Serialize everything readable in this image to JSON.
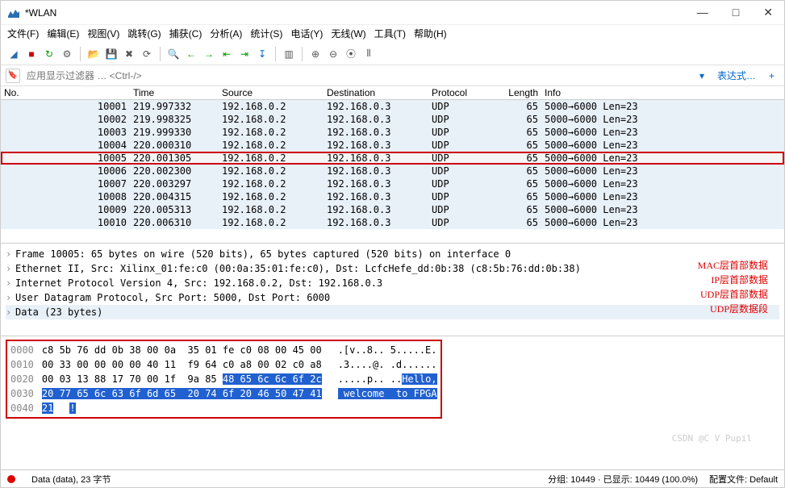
{
  "window": {
    "title": "*WLAN",
    "min": "—",
    "max": "□",
    "close": "✕"
  },
  "menu": {
    "file": "文件(F)",
    "edit": "编辑(E)",
    "view": "视图(V)",
    "goto": "跳转(G)",
    "capture": "捕获(C)",
    "analyze": "分析(A)",
    "stats": "统计(S)",
    "telephony": "电话(Y)",
    "wireless": "无线(W)",
    "tools": "工具(T)",
    "help": "帮助(H)"
  },
  "filter": {
    "placeholder": "应用显示过滤器 … <Ctrl-/>",
    "expr_label": "表达式…",
    "arrow": "▾",
    "plus": "+"
  },
  "columns": {
    "no": "No.",
    "time": "Time",
    "src": "Source",
    "dst": "Destination",
    "proto": "Protocol",
    "len": "Length",
    "info": "Info"
  },
  "packets": [
    {
      "no": "10001",
      "time": "219.997332",
      "src": "192.168.0.2",
      "dst": "192.168.0.3",
      "proto": "UDP",
      "len": "65",
      "info": "5000→6000 Len=23"
    },
    {
      "no": "10002",
      "time": "219.998325",
      "src": "192.168.0.2",
      "dst": "192.168.0.3",
      "proto": "UDP",
      "len": "65",
      "info": "5000→6000 Len=23"
    },
    {
      "no": "10003",
      "time": "219.999330",
      "src": "192.168.0.2",
      "dst": "192.168.0.3",
      "proto": "UDP",
      "len": "65",
      "info": "5000→6000 Len=23"
    },
    {
      "no": "10004",
      "time": "220.000310",
      "src": "192.168.0.2",
      "dst": "192.168.0.3",
      "proto": "UDP",
      "len": "65",
      "info": "5000→6000 Len=23"
    },
    {
      "no": "10005",
      "time": "220.001305",
      "src": "192.168.0.2",
      "dst": "192.168.0.3",
      "proto": "UDP",
      "len": "65",
      "info": "5000→6000 Len=23",
      "sel": true
    },
    {
      "no": "10006",
      "time": "220.002300",
      "src": "192.168.0.2",
      "dst": "192.168.0.3",
      "proto": "UDP",
      "len": "65",
      "info": "5000→6000 Len=23"
    },
    {
      "no": "10007",
      "time": "220.003297",
      "src": "192.168.0.2",
      "dst": "192.168.0.3",
      "proto": "UDP",
      "len": "65",
      "info": "5000→6000 Len=23"
    },
    {
      "no": "10008",
      "time": "220.004315",
      "src": "192.168.0.2",
      "dst": "192.168.0.3",
      "proto": "UDP",
      "len": "65",
      "info": "5000→6000 Len=23"
    },
    {
      "no": "10009",
      "time": "220.005313",
      "src": "192.168.0.2",
      "dst": "192.168.0.3",
      "proto": "UDP",
      "len": "65",
      "info": "5000→6000 Len=23"
    },
    {
      "no": "10010",
      "time": "220.006310",
      "src": "192.168.0.2",
      "dst": "192.168.0.3",
      "proto": "UDP",
      "len": "65",
      "info": "5000→6000 Len=23"
    }
  ],
  "details": {
    "frame": "Frame 10005: 65 bytes on wire (520 bits), 65 bytes captured (520 bits) on interface 0",
    "eth": "Ethernet II, Src: Xilinx_01:fe:c0 (00:0a:35:01:fe:c0), Dst: LcfcHefe_dd:0b:38 (c8:5b:76:dd:0b:38)",
    "ip": "Internet Protocol Version 4, Src: 192.168.0.2, Dst: 192.168.0.3",
    "udp": "User Datagram Protocol, Src Port: 5000, Dst Port: 6000",
    "data": "Data (23 bytes)"
  },
  "annotations": {
    "mac": "MAC层首部数据",
    "ip": "IP层首部数据",
    "udph": "UDP层首部数据",
    "udpd": "UDP层数据段"
  },
  "hex": {
    "rows": [
      {
        "off": "0000",
        "b1": "c8 5b 76 dd 0b 38 00 0a  35 01 fe c0 08 00 45 00",
        "asc": ".[v..8.. 5.....E."
      },
      {
        "off": "0010",
        "b1": "00 33 00 00 00 00 40 11  f9 64 c0 a8 00 02 c0 a8",
        "asc": ".3....@. .d......"
      },
      {
        "off": "0020",
        "b1": "00 03 13 88 17 70 00 1f  9a 85 ",
        "sel": "48 65 6c 6c 6f 2c",
        "asc": ".....p.. ..",
        "asc_sel": "Hello,"
      },
      {
        "off": "0030",
        "b1": "",
        "sel": "20 77 65 6c 63 6f 6d 65  20 74 6f 20 46 50 47 41",
        "asc": "",
        "asc_sel": " welcome  to FPGA"
      },
      {
        "off": "0040",
        "b1": "",
        "sel": "21",
        "asc": "",
        "asc_sel": "!"
      }
    ]
  },
  "status": {
    "left": "Data (data), 23 字节",
    "pkts": "分组: 10449 · 已显示: 10449 (100.0%)",
    "profile": "配置文件: Default"
  },
  "watermark": "CSDN @C V Pupil"
}
